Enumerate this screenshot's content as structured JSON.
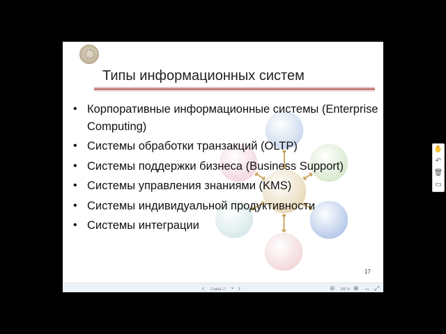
{
  "slide": {
    "title": "Типы информационных систем",
    "bullets": [
      {
        "text": "Корпоративные информационные системы (Enterprise Computing)"
      },
      {
        "text": "Системы обработки транзакций (OLTP)"
      },
      {
        "text": "Системы поддержки бизнеса (Business Support)"
      },
      {
        "text": "Системы управления знаниями (KMS)"
      },
      {
        "text": "Системы индивидуальной продуктивности"
      },
      {
        "text": "Системы интеграции"
      }
    ],
    "bullet_symbol": "•",
    "slide_number": "17",
    "diagram_colors": {
      "center": "#e6d3ad",
      "top": "#c2d3ea",
      "upper_right": "#d2e6c6",
      "lower_right": "#a8bfe6",
      "bottom": "#f1d1d4",
      "lower_left": "#d2e6e6",
      "upper_left": "#f1d1dc",
      "arrow": "#c9a766"
    }
  },
  "toolbar": {
    "prev_icon": "‹",
    "slide_label": "Слайд 17",
    "dropdown_icon": "⌄",
    "next_icon": "›",
    "zoom_out_icon": "⊖",
    "zoom_value": "100 %",
    "zoom_in_icon": "⊕",
    "fit_width_icon": "↔",
    "fullscreen_icon": "⤢"
  },
  "side_toolbar": {
    "hand_icon": "✋",
    "undo_icon": "↶",
    "delete_icon": "🗑",
    "comment_icon": "▭"
  }
}
